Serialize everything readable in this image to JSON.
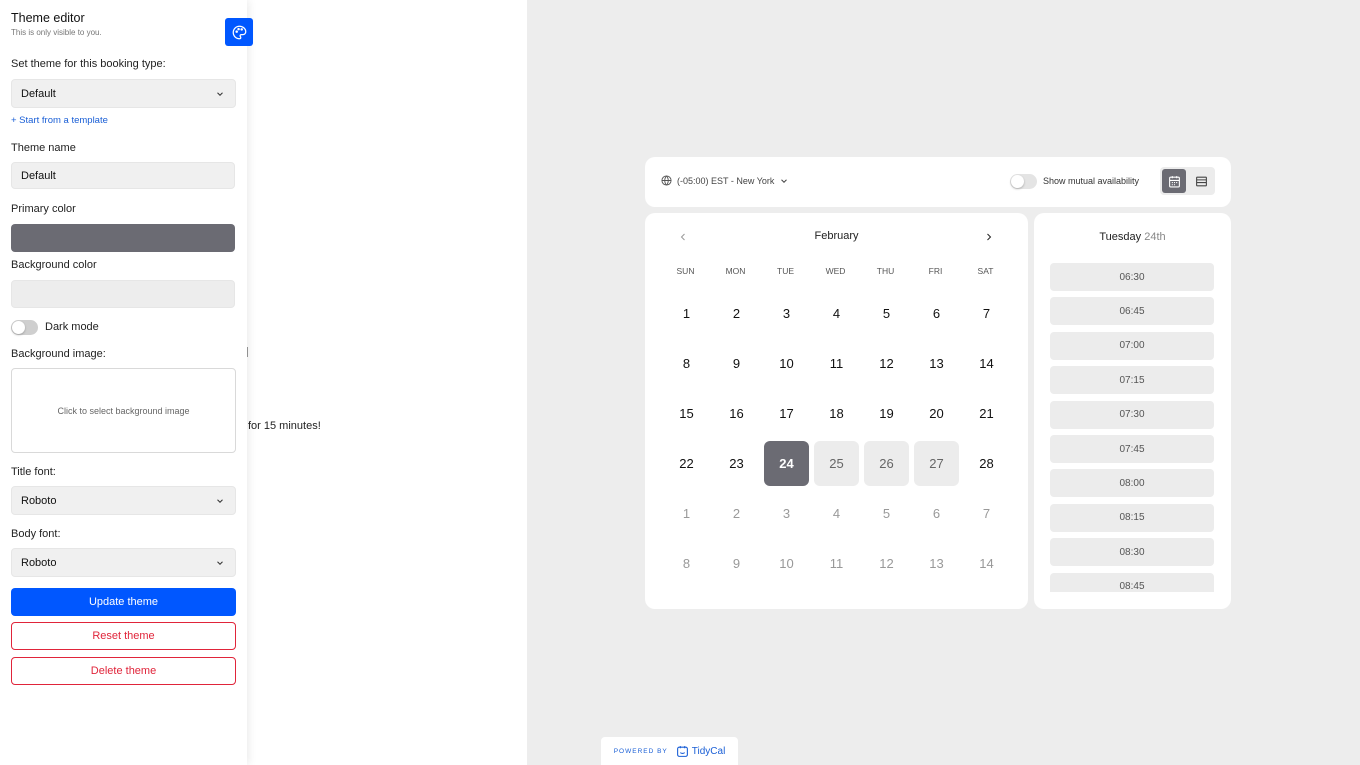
{
  "panel": {
    "title": "Theme editor",
    "subtitle": "This is only visible to you.",
    "booking_type_label": "Set theme for this booking type:",
    "booking_type_value": "Default",
    "start_template_link": "+ Start from a template",
    "theme_name_label": "Theme name",
    "theme_name_value": "Default",
    "primary_color_label": "Primary color",
    "primary_color": "#6b6b73",
    "background_color_label": "Background color",
    "background_color": "#ededed",
    "dark_mode_label": "Dark mode",
    "dark_mode": false,
    "background_image_label": "Background image:",
    "background_image_placeholder": "Click to select background image",
    "title_font_label": "Title font:",
    "title_font_value": "Roboto",
    "body_font_label": "Body font:",
    "body_font_value": "Roboto",
    "update_label": "Update theme",
    "reset_label": "Reset theme",
    "delete_label": "Delete theme",
    "accent": "#0057ff",
    "danger": "#e0243a"
  },
  "background": {
    "partial_text": "for 15 minutes!"
  },
  "booking": {
    "timezone": "(-05:00) EST - New York",
    "mutual_label": "Show mutual availability",
    "mutual_on": false,
    "active_view": "calendar",
    "month": "February",
    "weekdays": [
      "SUN",
      "MON",
      "TUE",
      "WED",
      "THU",
      "FRI",
      "SAT"
    ],
    "weeks": [
      [
        "1",
        "2",
        "3",
        "4",
        "5",
        "6",
        "7"
      ],
      [
        "8",
        "9",
        "10",
        "11",
        "12",
        "13",
        "14"
      ],
      [
        "15",
        "16",
        "17",
        "18",
        "19",
        "20",
        "21"
      ],
      [
        "22",
        "23",
        "24",
        "25",
        "26",
        "27",
        "28"
      ],
      [
        "1",
        "2",
        "3",
        "4",
        "5",
        "6",
        "7"
      ],
      [
        "8",
        "9",
        "10",
        "11",
        "12",
        "13",
        "14"
      ]
    ],
    "selected_day": "24",
    "available_days": [
      "25",
      "26",
      "27"
    ],
    "next_month_rows": [
      4,
      5
    ],
    "selected_weekday": "Tuesday",
    "selected_date_label": "24th",
    "slots": [
      "06:30",
      "06:45",
      "07:00",
      "07:15",
      "07:30",
      "07:45",
      "08:00",
      "08:15",
      "08:30",
      "08:45"
    ]
  },
  "footer": {
    "powered_by": "POWERED BY",
    "brand": "TidyCal"
  }
}
